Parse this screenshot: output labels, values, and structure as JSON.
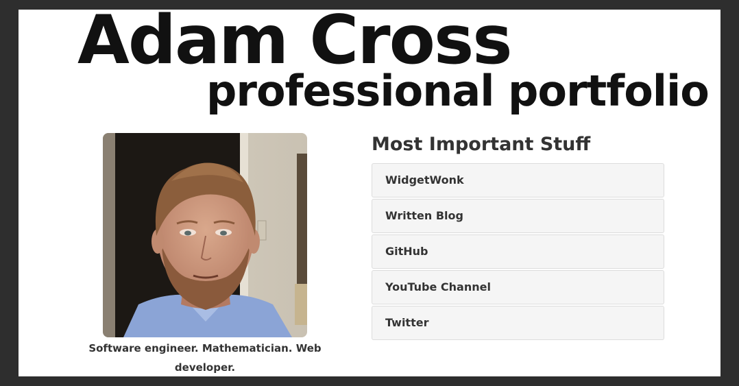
{
  "header": {
    "title": "Adam Cross",
    "subtitle": "professional portfolio"
  },
  "profile": {
    "caption": "Software engineer. Mathematician. Web developer."
  },
  "links_section": {
    "title": "Most Important Stuff",
    "items": [
      {
        "label": "WidgetWonk"
      },
      {
        "label": "Written Blog"
      },
      {
        "label": "GitHub"
      },
      {
        "label": "YouTube Channel"
      },
      {
        "label": "Twitter"
      }
    ]
  },
  "colors": {
    "frame": "#2e2e2e",
    "page_bg": "#ffffff",
    "link_bg": "#f5f5f5",
    "link_border": "#dcdcdc",
    "text": "#333333"
  }
}
